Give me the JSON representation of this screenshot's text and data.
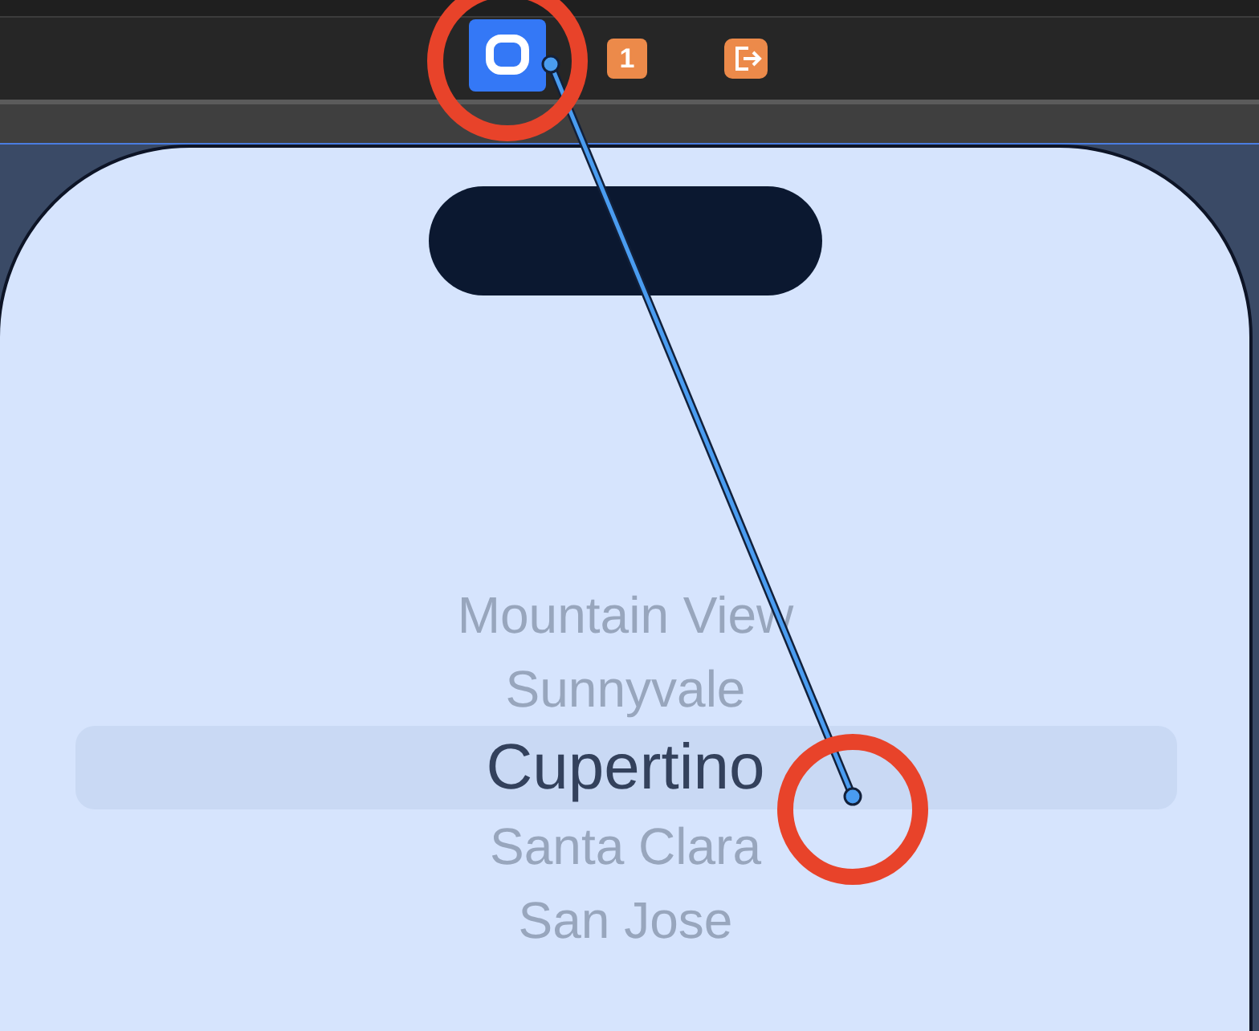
{
  "toolbar": {
    "icons": [
      {
        "kind": "controller",
        "selected": true
      },
      {
        "kind": "badge",
        "label": "1",
        "selected": false
      },
      {
        "kind": "exit",
        "selected": false
      }
    ]
  },
  "picker": {
    "rows": [
      {
        "label": "Mountain View",
        "selected": false
      },
      {
        "label": "Sunnyvale",
        "selected": false
      },
      {
        "label": "Cupertino",
        "selected": true
      },
      {
        "label": "Santa Clara",
        "selected": false
      },
      {
        "label": "San Jose",
        "selected": false
      }
    ]
  },
  "connection": {
    "dragging": true
  },
  "annotations": [
    {
      "kind": "ring"
    },
    {
      "kind": "ring"
    }
  ]
}
